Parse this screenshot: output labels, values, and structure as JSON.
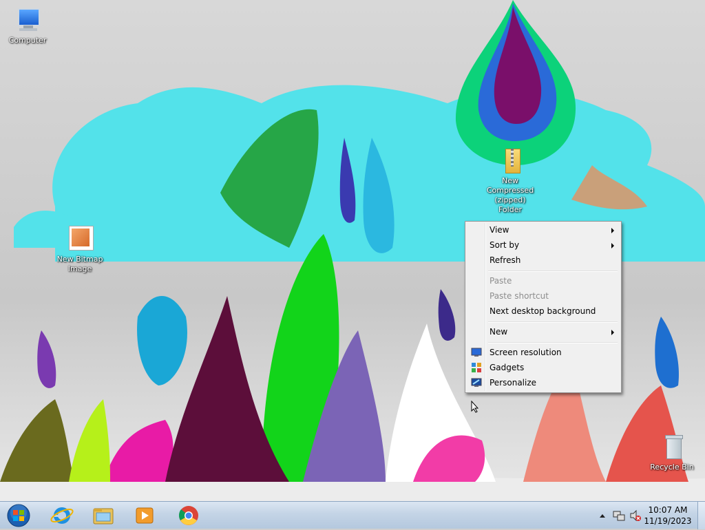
{
  "desktop_icons": {
    "computer": "Computer",
    "bitmap_line1": "New Bitmap",
    "bitmap_line2": "Image",
    "zip_line1": "New",
    "zip_line2": "Compressed",
    "zip_line3": "(zipped)",
    "zip_line4": "Folder",
    "recycle": "Recycle Bin"
  },
  "context_menu": {
    "view": "View",
    "sort_by": "Sort by",
    "refresh": "Refresh",
    "paste": "Paste",
    "paste_shortcut": "Paste shortcut",
    "next_bg": "Next desktop background",
    "new": "New",
    "screen_resolution": "Screen resolution",
    "gadgets": "Gadgets",
    "personalize": "Personalize"
  },
  "taskbar": {
    "pinned": [
      "start-orb-icon",
      "internet-explorer-icon",
      "windows-explorer-icon",
      "media-player-icon",
      "chrome-icon"
    ],
    "clock_time": "10:07 AM",
    "clock_date": "11/19/2023"
  },
  "colors": {
    "menu_bg": "#f0f0f0",
    "menu_disabled": "#8d8d8d",
    "taskbar": "#c4d4e6"
  }
}
